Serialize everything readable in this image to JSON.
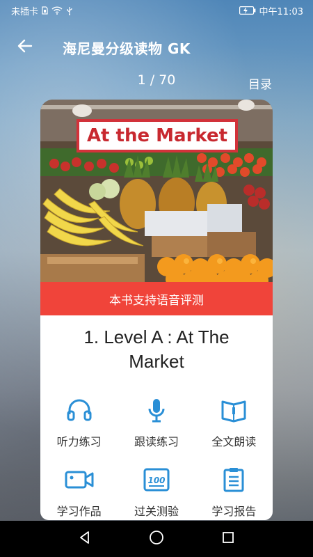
{
  "status_bar": {
    "carrier": "未插卡",
    "time": "中午11:03"
  },
  "header": {
    "title": "海尼曼分级读物 GK",
    "back_icon": "back-arrow-icon"
  },
  "pager": {
    "indicator": "1 / 70",
    "toc_label": "目录"
  },
  "book": {
    "cover_title": "At the Market",
    "voice_banner": "本书支持语音评测",
    "title": "1. Level A : At The Market"
  },
  "actions": [
    {
      "label": "听力练习",
      "icon": "headphones-icon"
    },
    {
      "label": "跟读练习",
      "icon": "microphone-icon"
    },
    {
      "label": "全文朗读",
      "icon": "open-book-icon"
    },
    {
      "label": "学习作品",
      "icon": "video-camera-icon"
    },
    {
      "label": "过关测验",
      "icon": "score-100-icon"
    },
    {
      "label": "学习报告",
      "icon": "clipboard-report-icon"
    }
  ],
  "colors": {
    "accent_blue": "#2a8fd6",
    "banner_red": "#f0443a",
    "cover_title_red": "#c8282f"
  }
}
